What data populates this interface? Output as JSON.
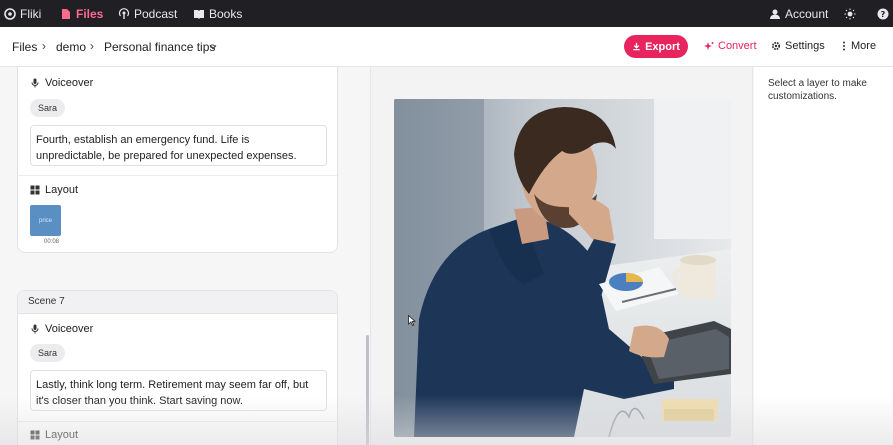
{
  "topnav": {
    "brand": "Fliki",
    "files": "Files",
    "podcast": "Podcast",
    "books": "Books",
    "account": "Account"
  },
  "breadcrumb": {
    "root": "Files",
    "folder": "demo",
    "file": "Personal finance tips"
  },
  "toolbar": {
    "export_label": "Export",
    "convert_label": "Convert",
    "settings_label": "Settings",
    "more_label": "More"
  },
  "scene6": {
    "voiceover_label": "Voiceover",
    "voice_name": "Sara",
    "text": "Fourth, establish an emergency fund. Life is unpredictable, be prepared for unexpected expenses.",
    "layout_label": "Layout",
    "thumb_text": "price",
    "thumb_time": "00:08"
  },
  "scene7": {
    "title": "Scene 7",
    "voiceover_label": "Voiceover",
    "voice_name": "Sara",
    "text": "Lastly, think long term. Retirement may seem far off, but it's closer than you think. Start saving now.",
    "layout_label": "Layout"
  },
  "right_panel": {
    "hint": "Select a layer to make customizations."
  },
  "colors": {
    "accent": "#e8245f",
    "nav_bg": "#1f1f24"
  }
}
